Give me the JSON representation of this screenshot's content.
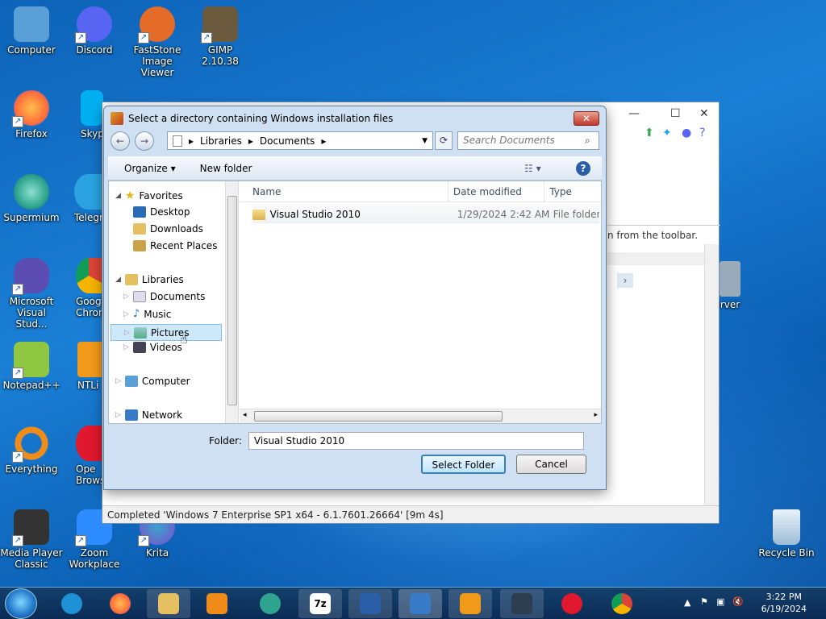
{
  "desktop": {
    "icons": [
      {
        "label": "Computer",
        "icon": "computer-icon",
        "color": "#5a9fd6"
      },
      {
        "label": "Discord",
        "icon": "discord-icon",
        "color": "#5865f2"
      },
      {
        "label": "FastStone Image Viewer",
        "icon": "faststone-icon",
        "color": "#e46b28"
      },
      {
        "label": "GIMP 2.10.38",
        "icon": "gimp-icon",
        "color": "#6b5a3e"
      },
      {
        "label": "Firefox",
        "icon": "firefox-icon",
        "color": "#ff7139"
      },
      {
        "label": "Skyp",
        "icon": "skype-icon",
        "color": "#00aff0"
      },
      {
        "label": "Supermium",
        "icon": "supermium-icon",
        "color": "#2fa58f"
      },
      {
        "label": "Telegr",
        "icon": "telegram-icon",
        "color": "#2aa3e0"
      },
      {
        "label": "Microsoft Visual Stud...",
        "icon": "visual-studio-icon",
        "color": "#5b4db2"
      },
      {
        "label": "Goog Chron",
        "icon": "chrome-icon",
        "color": "#3aa757"
      },
      {
        "label": "Notepad++",
        "icon": "notepadpp-icon",
        "color": "#8fc742"
      },
      {
        "label": "NTLi",
        "icon": "ntlite-icon",
        "color": "#f19a1a"
      },
      {
        "label": "Everything",
        "icon": "everything-icon",
        "color": "#f08c1a"
      },
      {
        "label": "Ope Brows",
        "icon": "opera-icon",
        "color": "#e0182d"
      },
      {
        "label": "Media Player Classic",
        "icon": "media-player-icon",
        "color": "#333333"
      },
      {
        "label": "Zoom Workplace",
        "icon": "zoom-icon",
        "color": "#2d8cff"
      },
      {
        "label": "Krita",
        "icon": "krita-icon",
        "color": "#3ba3d0"
      },
      {
        "label": "Recycle Bin",
        "icon": "recycle-bin-icon",
        "color": "#b8d4e8"
      },
      {
        "label": "rver",
        "icon": "server-icon",
        "color": "#9ab"
      }
    ]
  },
  "bgwin": {
    "hint": "n from the toolbar.",
    "status": "Completed  'Windows 7 Enterprise SP1 x64 - 6.1.7601.26664' [9m 4s]"
  },
  "dialog": {
    "title": "Select a directory containing Windows installation files",
    "close": "✕",
    "breadcrumb": [
      "Libraries",
      "Documents"
    ],
    "search_placeholder": "Search Documents",
    "toolbar": {
      "organize": "Organize ▾",
      "new_folder": "New folder"
    },
    "nav": {
      "favorites": "Favorites",
      "desktop": "Desktop",
      "downloads": "Downloads",
      "recent": "Recent Places",
      "libraries": "Libraries",
      "documents": "Documents",
      "music": "Music",
      "pictures": "Pictures",
      "videos": "Videos",
      "computer": "Computer",
      "network": "Network"
    },
    "columns": {
      "name": "Name",
      "date": "Date modified",
      "type": "Type"
    },
    "files": [
      {
        "name": "Visual Studio 2010",
        "date": "1/29/2024 2:42 AM",
        "type": "File folder"
      }
    ],
    "folder_label": "Folder:",
    "folder_value": "Visual Studio 2010",
    "select_button": "Select Folder",
    "cancel_button": "Cancel"
  },
  "taskbar": {
    "time": "3:22 PM",
    "date": "6/19/2024"
  }
}
